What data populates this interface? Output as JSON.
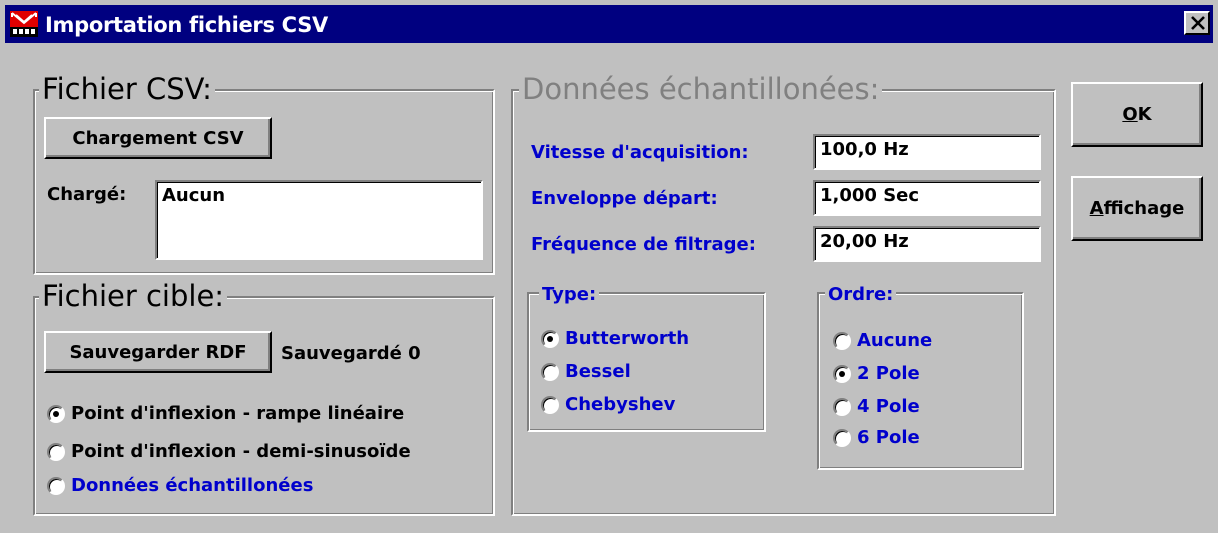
{
  "window": {
    "title": "Importation fichiers CSV",
    "close_symbol": "×"
  },
  "source_group": {
    "legend": "Fichier CSV:",
    "load_button": "Chargement CSV",
    "loaded_label": "Chargé:",
    "loaded_value": "Aucun"
  },
  "target_group": {
    "legend": "Fichier cible:",
    "save_button": "Sauvegarder RDF",
    "saved_status": "Sauvegardé 0",
    "options": [
      {
        "label": "Point d'inflexion - rampe linéaire",
        "selected": true
      },
      {
        "label": "Point d'inflexion - demi-sinusoïde",
        "selected": false
      },
      {
        "label": "Données échantillonées",
        "selected": false
      }
    ]
  },
  "sampled_group": {
    "legend": "Données échantillonées:",
    "fields": [
      {
        "label": "Vitesse d'acquisition:",
        "value": "100,0 Hz"
      },
      {
        "label": "Enveloppe départ:",
        "value": "1,000 Sec"
      },
      {
        "label": "Fréquence de filtrage:",
        "value": "20,00 Hz"
      }
    ],
    "type": {
      "legend": "Type:",
      "options": [
        {
          "label": "Butterworth",
          "selected": true
        },
        {
          "label": "Bessel",
          "selected": false
        },
        {
          "label": "Chebyshev",
          "selected": false
        }
      ]
    },
    "order": {
      "legend": "Ordre:",
      "options": [
        {
          "label": "Aucune",
          "selected": false
        },
        {
          "label": "2 Pole",
          "selected": true
        },
        {
          "label": "4 Pole",
          "selected": false
        },
        {
          "label": "6 Pole",
          "selected": false
        }
      ]
    }
  },
  "actions": {
    "ok_label": "OK",
    "display_label": "Affichage"
  },
  "colors": {
    "titlebar": "#000080",
    "face": "#c0c0c0",
    "label_blue": "#0000cc",
    "disabled_gray": "#808080"
  }
}
